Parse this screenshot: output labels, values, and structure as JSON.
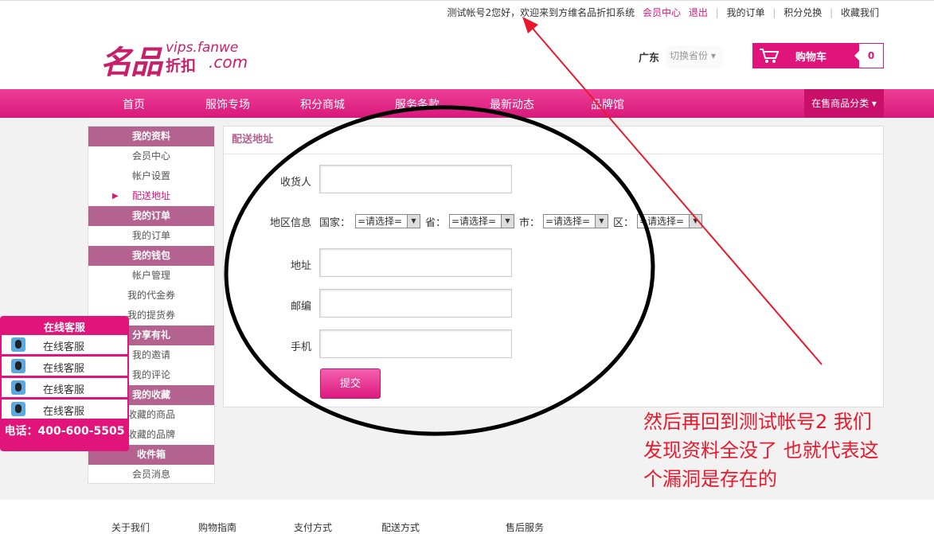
{
  "topbar": {
    "greeting": "测试帐号2您好，欢迎来到方维名品折扣系统",
    "member_center": "会员中心",
    "logout": "退出",
    "my_orders": "我的订单",
    "points_exchange": "积分兑换",
    "favorites": "收藏我们"
  },
  "logo": {
    "big": "名品",
    "url": "vips.fanwe",
    "sub": "折扣",
    "com": ".com"
  },
  "header": {
    "province": "广东",
    "province_switch": "切换省份 ▾",
    "cart_label": "购物车",
    "cart_count": "0"
  },
  "nav": {
    "items": [
      "首页",
      "服饰专场",
      "积分商城",
      "服务条款",
      "最新动态",
      "品牌馆"
    ],
    "category": "在售商品分类 ▾"
  },
  "sidebar": {
    "sections": [
      {
        "title": "我的资料",
        "items": [
          "会员中心",
          "帐户设置",
          "配送地址"
        ]
      },
      {
        "title": "我的订单",
        "items": [
          "我的订单"
        ]
      },
      {
        "title": "我的钱包",
        "items": [
          "帐户管理",
          "我的代金券",
          "我的提货券"
        ]
      },
      {
        "title": "分享有礼",
        "items": [
          "我的邀请",
          "我的评论"
        ]
      },
      {
        "title": "我的收藏",
        "items": [
          "收藏的商品",
          "收藏的品牌"
        ]
      },
      {
        "title": "收件箱",
        "items": [
          "会员消息"
        ]
      }
    ],
    "active_arrow": "▶"
  },
  "form": {
    "title": "配送地址",
    "receiver_label": "收货人",
    "region_label": "地区信息",
    "country_label": "国家：",
    "province_label": "省：",
    "city_label": "市：",
    "district_label": "区：",
    "select_default": "=请选择=",
    "address_label": "地址",
    "zip_label": "邮编",
    "phone_label": "手机",
    "submit": "提交"
  },
  "kefu": {
    "title": "在线客服",
    "rows": [
      "在线客服",
      "在线客服",
      "在线客服",
      "在线客服"
    ],
    "tel": "电话：400-600-5505"
  },
  "footer": {
    "links": [
      "关于我们",
      "购物指南",
      "支付方式",
      "配送方式",
      "售后服务"
    ]
  },
  "annotation": {
    "lines": [
      "然后再回到测试帐号2 我们",
      "发现资料全没了 也就代表这",
      "个漏洞是存在的"
    ],
    "color": "#e8192c"
  }
}
